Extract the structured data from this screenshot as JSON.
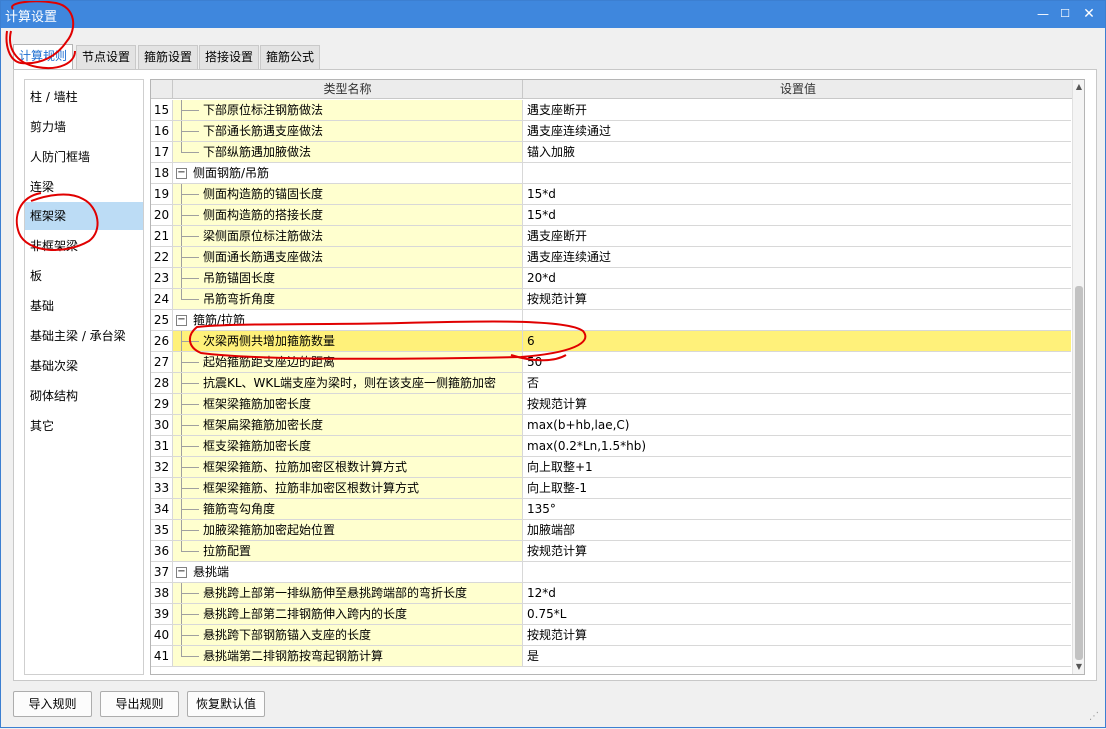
{
  "window": {
    "title": "计算设置",
    "min_icon": "minimize-icon",
    "max_icon": "maximize-icon",
    "close_icon": "close-icon",
    "min_glyph": "—",
    "max_glyph": "☐",
    "close_glyph": "✕"
  },
  "tabs": [
    {
      "label": "计算规则",
      "active": true
    },
    {
      "label": "节点设置",
      "active": false
    },
    {
      "label": "箍筋设置",
      "active": false
    },
    {
      "label": "搭接设置",
      "active": false
    },
    {
      "label": "箍筋公式",
      "active": false
    }
  ],
  "sidebar": {
    "items": [
      {
        "label": "柱 / 墙柱"
      },
      {
        "label": "剪力墙"
      },
      {
        "label": "人防门框墙"
      },
      {
        "label": "连梁"
      },
      {
        "label": "框架梁",
        "selected": true
      },
      {
        "label": "非框架梁"
      },
      {
        "label": "板"
      },
      {
        "label": "基础"
      },
      {
        "label": "基础主梁 / 承台梁"
      },
      {
        "label": "基础次梁"
      },
      {
        "label": "砌体结构"
      },
      {
        "label": "其它"
      }
    ]
  },
  "grid": {
    "columns": {
      "name": "类型名称",
      "value": "设置值"
    },
    "rows": [
      {
        "n": "15",
        "name": "下部原位标注钢筋做法",
        "value": "遇支座断开",
        "type": "leaf"
      },
      {
        "n": "16",
        "name": "下部通长筋遇支座做法",
        "value": "遇支座连续通过",
        "type": "leaf"
      },
      {
        "n": "17",
        "name": "下部纵筋遇加腋做法",
        "value": "锚入加腋",
        "type": "leaf",
        "last": true
      },
      {
        "n": "18",
        "name": "侧面钢筋/吊筋",
        "value": "",
        "type": "group"
      },
      {
        "n": "19",
        "name": "侧面构造筋的锚固长度",
        "value": "15*d",
        "type": "leaf"
      },
      {
        "n": "20",
        "name": "侧面构造筋的搭接长度",
        "value": "15*d",
        "type": "leaf"
      },
      {
        "n": "21",
        "name": "梁侧面原位标注筋做法",
        "value": "遇支座断开",
        "type": "leaf"
      },
      {
        "n": "22",
        "name": "侧面通长筋遇支座做法",
        "value": "遇支座连续通过",
        "type": "leaf"
      },
      {
        "n": "23",
        "name": "吊筋锚固长度",
        "value": "20*d",
        "type": "leaf"
      },
      {
        "n": "24",
        "name": "吊筋弯折角度",
        "value": "按规范计算",
        "type": "leaf",
        "last": true
      },
      {
        "n": "25",
        "name": "箍筋/拉筋",
        "value": "",
        "type": "group"
      },
      {
        "n": "26",
        "name": "次梁两侧共增加箍筋数量",
        "value": "6",
        "type": "leaf",
        "highlight": true
      },
      {
        "n": "27",
        "name": "起始箍筋距支座边的距离",
        "value": "50",
        "type": "leaf"
      },
      {
        "n": "28",
        "name": "抗震KL、WKL端支座为梁时，则在该支座一侧箍筋加密",
        "value": "否",
        "type": "leaf"
      },
      {
        "n": "29",
        "name": "框架梁箍筋加密长度",
        "value": "按规范计算",
        "type": "leaf"
      },
      {
        "n": "30",
        "name": "框架扁梁箍筋加密长度",
        "value": "max(b+hb,lae,C)",
        "type": "leaf"
      },
      {
        "n": "31",
        "name": "框支梁箍筋加密长度",
        "value": "max(0.2*Ln,1.5*hb)",
        "type": "leaf"
      },
      {
        "n": "32",
        "name": "框架梁箍筋、拉筋加密区根数计算方式",
        "value": "向上取整+1",
        "type": "leaf"
      },
      {
        "n": "33",
        "name": "框架梁箍筋、拉筋非加密区根数计算方式",
        "value": "向上取整-1",
        "type": "leaf"
      },
      {
        "n": "34",
        "name": "箍筋弯勾角度",
        "value": "135°",
        "type": "leaf"
      },
      {
        "n": "35",
        "name": "加腋梁箍筋加密起始位置",
        "value": "加腋端部",
        "type": "leaf"
      },
      {
        "n": "36",
        "name": "拉筋配置",
        "value": "按规范计算",
        "type": "leaf",
        "last": true
      },
      {
        "n": "37",
        "name": "悬挑端",
        "value": "",
        "type": "group"
      },
      {
        "n": "38",
        "name": "悬挑跨上部第一排纵筋伸至悬挑跨端部的弯折长度",
        "value": "12*d",
        "type": "leaf"
      },
      {
        "n": "39",
        "name": "悬挑跨上部第二排钢筋伸入跨内的长度",
        "value": "0.75*L",
        "type": "leaf"
      },
      {
        "n": "40",
        "name": "悬挑跨下部钢筋锚入支座的长度",
        "value": "按规范计算",
        "type": "leaf"
      },
      {
        "n": "41",
        "name": "悬挑端第二排钢筋按弯起钢筋计算",
        "value": "是",
        "type": "leaf",
        "last": true
      }
    ],
    "collapse_glyph": "−"
  },
  "buttons": {
    "import": "导入规则",
    "export": "导出规则",
    "restore": "恢复默认值"
  },
  "colors": {
    "titlebar": "#3f87dd",
    "name_cell": "#ffffcf",
    "highlight": "#fff17a",
    "selected": "#bcdcf5",
    "annotation": "#e00000"
  }
}
